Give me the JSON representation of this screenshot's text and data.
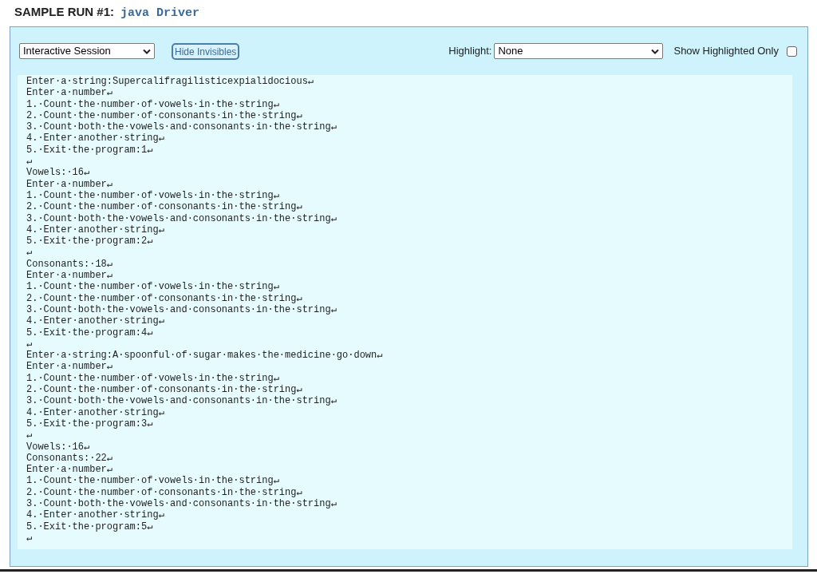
{
  "heading": {
    "label": "SAMPLE RUN #1:",
    "command": "java Driver"
  },
  "toolbar": {
    "mode_select": "Interactive Session",
    "toggle_button": "Hide Invisibles",
    "highlight_label": "Highlight:",
    "highlight_select": "None",
    "show_highlighted_only": {
      "label": "Show Highlighted Only",
      "checked": false
    }
  },
  "output_lines": [
    "Enter·a·string:Supercalifragilisticexpialidocious↵",
    "Enter·a·number↵",
    "1.·Count·the·number·of·vowels·in·the·string↵",
    "2.·Count·the·number·of·consonants·in·the·string↵",
    "3.·Count·both·the·vowels·and·consonants·in·the·string↵",
    "4.·Enter·another·string↵",
    "5.·Exit·the·program:1↵",
    "↵",
    "Vowels:·16↵",
    "Enter·a·number↵",
    "1.·Count·the·number·of·vowels·in·the·string↵",
    "2.·Count·the·number·of·consonants·in·the·string↵",
    "3.·Count·both·the·vowels·and·consonants·in·the·string↵",
    "4.·Enter·another·string↵",
    "5.·Exit·the·program:2↵",
    "↵",
    "Consonants:·18↵",
    "Enter·a·number↵",
    "1.·Count·the·number·of·vowels·in·the·string↵",
    "2.·Count·the·number·of·consonants·in·the·string↵",
    "3.·Count·both·the·vowels·and·consonants·in·the·string↵",
    "4.·Enter·another·string↵",
    "5.·Exit·the·program:4↵",
    "↵",
    "Enter·a·string:A·spoonful·of·sugar·makes·the·medicine·go·down↵",
    "Enter·a·number↵",
    "1.·Count·the·number·of·vowels·in·the·string↵",
    "2.·Count·the·number·of·consonants·in·the·string↵",
    "3.·Count·both·the·vowels·and·consonants·in·the·string↵",
    "4.·Enter·another·string↵",
    "5.·Exit·the·program:3↵",
    "↵",
    "Vowels:·16↵",
    "Consonants:·22↵",
    "Enter·a·number↵",
    "1.·Count·the·number·of·vowels·in·the·string↵",
    "2.·Count·the·number·of·consonants·in·the·string↵",
    "3.·Count·both·the·vowels·and·consonants·in·the·string↵",
    "4.·Enter·another·string↵",
    "5.·Exit·the·program:5↵",
    "↵"
  ]
}
